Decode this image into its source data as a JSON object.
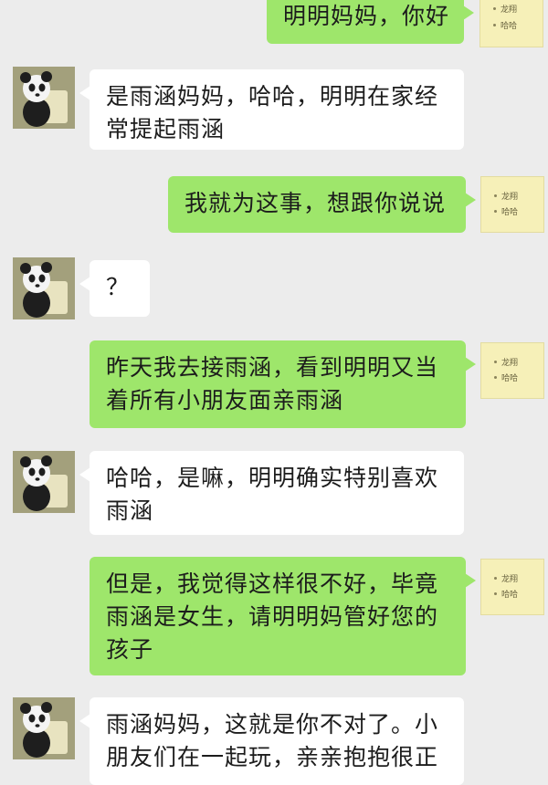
{
  "messages": [
    {
      "side": "right",
      "text": "明明妈妈，你好"
    },
    {
      "side": "left",
      "text": "是雨涵妈妈，哈哈，明明在家经\n常提起雨涵"
    },
    {
      "side": "right",
      "text": "我就为这事，想跟你说说"
    },
    {
      "side": "left",
      "text": "？"
    },
    {
      "side": "right",
      "text": "昨天我去接雨涵，看到明明又当\n着所有小朋友面亲雨涵"
    },
    {
      "side": "left",
      "text": "哈哈，是嘛，明明确实特别喜欢\n雨涵"
    },
    {
      "side": "right",
      "text": "但是，我觉得这样很不好，毕竟\n雨涵是女生，请明明妈管好您的\n孩子"
    },
    {
      "side": "left",
      "text": "雨涵妈妈，这就是你不对了。小\n朋友们在一起玩，亲亲抱抱很正"
    }
  ],
  "my_avatar": {
    "line1": "龙翔",
    "line2": "哈哈"
  },
  "colors": {
    "mine_bubble": "#9ee66b",
    "their_bubble": "#ffffff",
    "background": "#ececec"
  }
}
